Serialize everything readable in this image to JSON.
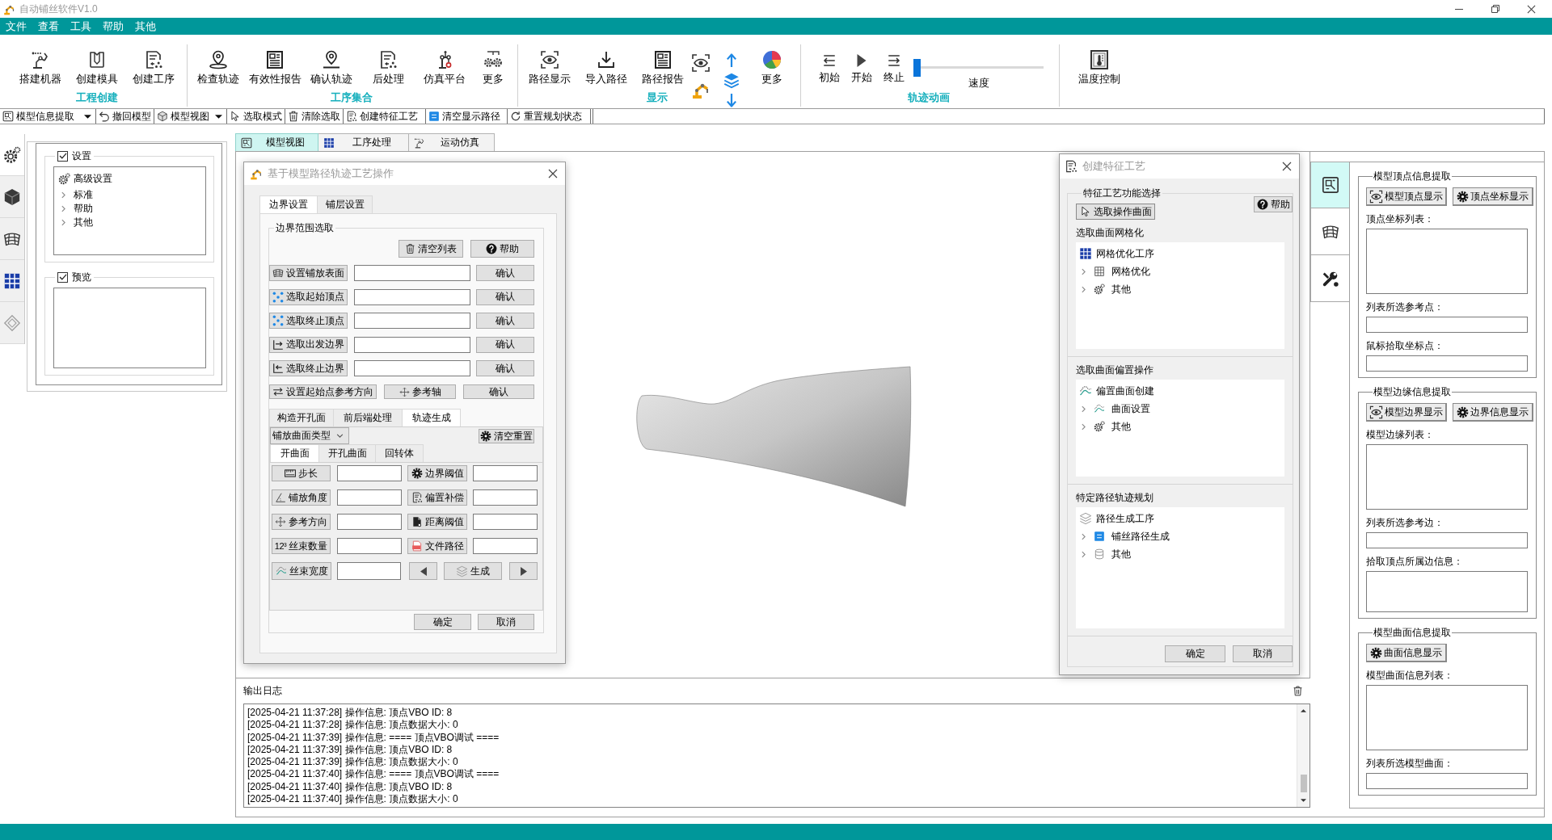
{
  "window": {
    "title": "自动铺丝软件V1.0"
  },
  "menu": [
    "文件",
    "查看",
    "工具",
    "帮助",
    "其他"
  ],
  "ribbon": [
    {
      "label": "工程创建",
      "items": [
        {
          "kind": "button",
          "label": "搭建机器"
        },
        {
          "kind": "button",
          "label": "创建模具"
        },
        {
          "kind": "button",
          "label": "创建工序"
        }
      ]
    },
    {
      "label": "工序集合",
      "items": [
        {
          "kind": "button",
          "label": "检查轨迹"
        },
        {
          "kind": "button",
          "label": "有效性报告"
        },
        {
          "kind": "button",
          "label": "确认轨迹"
        },
        {
          "kind": "button",
          "label": "后处理"
        },
        {
          "kind": "button",
          "label": "仿真平台"
        },
        {
          "kind": "button",
          "label": "更多"
        }
      ]
    },
    {
      "label": "显示",
      "items": [
        {
          "kind": "button",
          "label": "路径显示"
        },
        {
          "kind": "button",
          "label": "导入路径"
        },
        {
          "kind": "button",
          "label": "路径报告"
        },
        {
          "kind": "icon-stack"
        },
        {
          "kind": "icon-stack"
        },
        {
          "kind": "button",
          "label": "更多"
        }
      ]
    },
    {
      "label": "轨迹动画",
      "items": [
        {
          "kind": "small",
          "label": "初始"
        },
        {
          "kind": "small",
          "label": "开始"
        },
        {
          "kind": "small",
          "label": "终止"
        },
        {
          "kind": "slider",
          "label": "速度",
          "level": 0
        }
      ]
    },
    {
      "items": [
        {
          "kind": "button",
          "label": "温度控制"
        }
      ]
    }
  ],
  "toolbar": [
    {
      "label": "模型信息提取",
      "dropdown": true
    },
    {
      "label": "撤回模型",
      "dropdown": false
    },
    {
      "label": "模型视图",
      "dropdown": true
    },
    {
      "label": "选取模式",
      "dropdown": false
    },
    {
      "label": "清除选取",
      "dropdown": false
    },
    {
      "label": "创建特征工艺",
      "dropdown": false
    },
    {
      "label": "清空显示路径",
      "dropdown": false
    },
    {
      "label": "重置规划状态",
      "dropdown": false
    }
  ],
  "side_tabs": [
    {
      "selected": true
    },
    {
      "selected": false
    },
    {
      "selected": false
    },
    {
      "selected": false
    },
    {
      "selected": false
    }
  ],
  "settings_panel": {
    "groups": [
      {
        "title": "设置",
        "checked": true,
        "tree": [
          {
            "label": "高级设置",
            "children": [
              {
                "label": "标准",
                "expanded": false
              },
              {
                "label": "帮助",
                "expanded": false
              },
              {
                "label": "其他",
                "expanded": false
              }
            ]
          }
        ]
      },
      {
        "title": "预览",
        "checked": true
      }
    ]
  },
  "workspace_tabs": [
    {
      "label": "模型视图",
      "selected": true
    },
    {
      "label": "工序处理",
      "selected": false
    },
    {
      "label": "运动仿真",
      "selected": false
    }
  ],
  "path_dialog": {
    "title": "基于模型路径轨迹工艺操作",
    "tabs": [
      {
        "label": "边界设置",
        "selected": true
      },
      {
        "label": "铺层设置",
        "selected": false
      }
    ],
    "group_title": "边界范围选取",
    "clear_button": "清空列表",
    "help_button": "帮助",
    "pick_rows": [
      {
        "button": "设置铺放表面",
        "confirm": "确认"
      },
      {
        "button": "选取起始顶点",
        "confirm": "确认"
      },
      {
        "button": "选取终止顶点",
        "confirm": "确认"
      },
      {
        "button": "选取出发边界",
        "confirm": "确认"
      },
      {
        "button": "选取终止边界",
        "confirm": "确认"
      }
    ],
    "direction_row": {
      "button": "设置起始点参考方向",
      "axis_button": "参考轴",
      "confirm": "确认"
    },
    "sub_tabs": [
      {
        "label": "构造开孔面",
        "selected": false
      },
      {
        "label": "前后端处理",
        "selected": false
      },
      {
        "label": "轨迹生成",
        "selected": true
      }
    ],
    "surface_type": "铺放曲面类型",
    "reset_button": "清空重置",
    "surface_tabs": [
      {
        "label": "开曲面",
        "selected": true
      },
      {
        "label": "开孔曲面",
        "selected": false
      },
      {
        "label": "回转体",
        "selected": false
      }
    ],
    "params": [
      {
        "label": "步长"
      },
      {
        "label": "边界阈值"
      },
      {
        "label": "铺放角度"
      },
      {
        "label": "偏置补偿"
      },
      {
        "label": "参考方向"
      },
      {
        "label": "距离阈值"
      },
      {
        "label": "丝束数量",
        "glyph": "12³"
      },
      {
        "label": "文件路径"
      },
      {
        "label": "丝束宽度"
      }
    ],
    "generate_button": "生成",
    "buttons": [
      "确定",
      "取消"
    ]
  },
  "feature_dialog": {
    "title": "创建特征工艺",
    "group_title": "特征工艺功能选择",
    "select_button": "选取操作曲面",
    "help_button": "帮助",
    "sections": [
      {
        "title": "选取曲面网格化",
        "tree": [
          {
            "label": "网格优化工序",
            "children": [
              {
                "label": "网格优化",
                "expanded": false
              },
              {
                "label": "其他",
                "expanded": false
              }
            ]
          }
        ]
      },
      {
        "title": "选取曲面偏置操作",
        "tree": [
          {
            "label": "偏置曲面创建",
            "children": [
              {
                "label": "曲面设置",
                "expanded": false
              },
              {
                "label": "其他",
                "expanded": false
              }
            ]
          }
        ]
      },
      {
        "title": "特定路径轨迹规划",
        "tree": [
          {
            "label": "路径生成工序",
            "children": [
              {
                "label": "铺丝路径生成",
                "expanded": false
              },
              {
                "label": "其他",
                "expanded": false
              }
            ]
          }
        ]
      }
    ],
    "buttons": [
      "确定",
      "取消"
    ]
  },
  "log": {
    "title": "输出日志",
    "lines": [
      "[2025-04-21 11:37:28] 操作信息: 顶点VBO ID: 8",
      "[2025-04-21 11:37:28] 操作信息: 顶点数据大小: 0",
      "[2025-04-21 11:37:39] 操作信息: ==== 顶点VBO调试 ====",
      "[2025-04-21 11:37:39] 操作信息: 顶点VBO ID: 8",
      "[2025-04-21 11:37:39] 操作信息: 顶点数据大小: 0",
      "[2025-04-21 11:37:40] 操作信息: ==== 顶点VBO调试 ====",
      "[2025-04-21 11:37:40] 操作信息: 顶点VBO ID: 8",
      "[2025-04-21 11:37:40] 操作信息: 顶点数据大小: 0"
    ]
  },
  "right_tabs": [
    {
      "selected": true
    },
    {
      "selected": false
    },
    {
      "selected": false
    }
  ],
  "info_panel": [
    {
      "title": "模型顶点信息提取",
      "buttons": [
        "模型顶点显示",
        "顶点坐标显示"
      ],
      "fields": [
        {
          "kind": "list",
          "label": "顶点坐标列表："
        },
        {
          "kind": "line",
          "label": "列表所选参考点："
        },
        {
          "kind": "line",
          "label": "鼠标拾取坐标点："
        }
      ]
    },
    {
      "title": "模型边缘信息提取",
      "buttons": [
        "模型边界显示",
        "边界信息显示"
      ],
      "fields": [
        {
          "kind": "list",
          "label": "模型边缘列表："
        },
        {
          "kind": "line",
          "label": "列表所选参考边："
        },
        {
          "kind": "memo",
          "label": "拾取顶点所属边信息："
        }
      ]
    },
    {
      "title": "模型曲面信息提取",
      "buttons": [
        "曲面信息显示"
      ],
      "fields": [
        {
          "kind": "list",
          "label": "模型曲面信息列表："
        },
        {
          "kind": "line",
          "label": "列表所选模型曲面："
        }
      ]
    }
  ]
}
